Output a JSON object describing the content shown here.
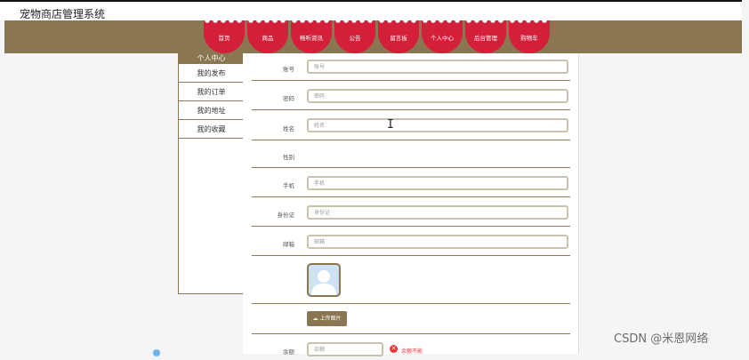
{
  "site": {
    "title": "宠物商店管理系统"
  },
  "nav": {
    "items": [
      "首页",
      "商品",
      "畅听资讯",
      "公告",
      "留言板",
      "个人中心",
      "后台管理",
      "购物车"
    ]
  },
  "sidebar": {
    "header": "个人中心",
    "items": [
      "我的发布",
      "我的订单",
      "我的地址",
      "我的收藏"
    ]
  },
  "form": {
    "account": {
      "label": "账号",
      "placeholder": "账号"
    },
    "password": {
      "label": "密码",
      "placeholder": "密码"
    },
    "name": {
      "label": "姓名",
      "placeholder": "姓名"
    },
    "gender": {
      "label": "性别"
    },
    "phone": {
      "label": "手机",
      "placeholder": "手机"
    },
    "id_card": {
      "label": "身份证",
      "placeholder": "身份证"
    },
    "email": {
      "label": "邮箱",
      "placeholder": "邮箱"
    },
    "upload_button": "上传图片",
    "balance": {
      "label": "余额",
      "placeholder": "余额",
      "error": "余额不能"
    }
  },
  "watermark": "CSDN @米恩网络",
  "colors": {
    "nav_bg": "#8a7650",
    "nav_item": "#d41f3a",
    "accent": "#8a7650"
  },
  "icons": {
    "upload": "cloud-upload-icon",
    "error": "close-circle-icon"
  }
}
